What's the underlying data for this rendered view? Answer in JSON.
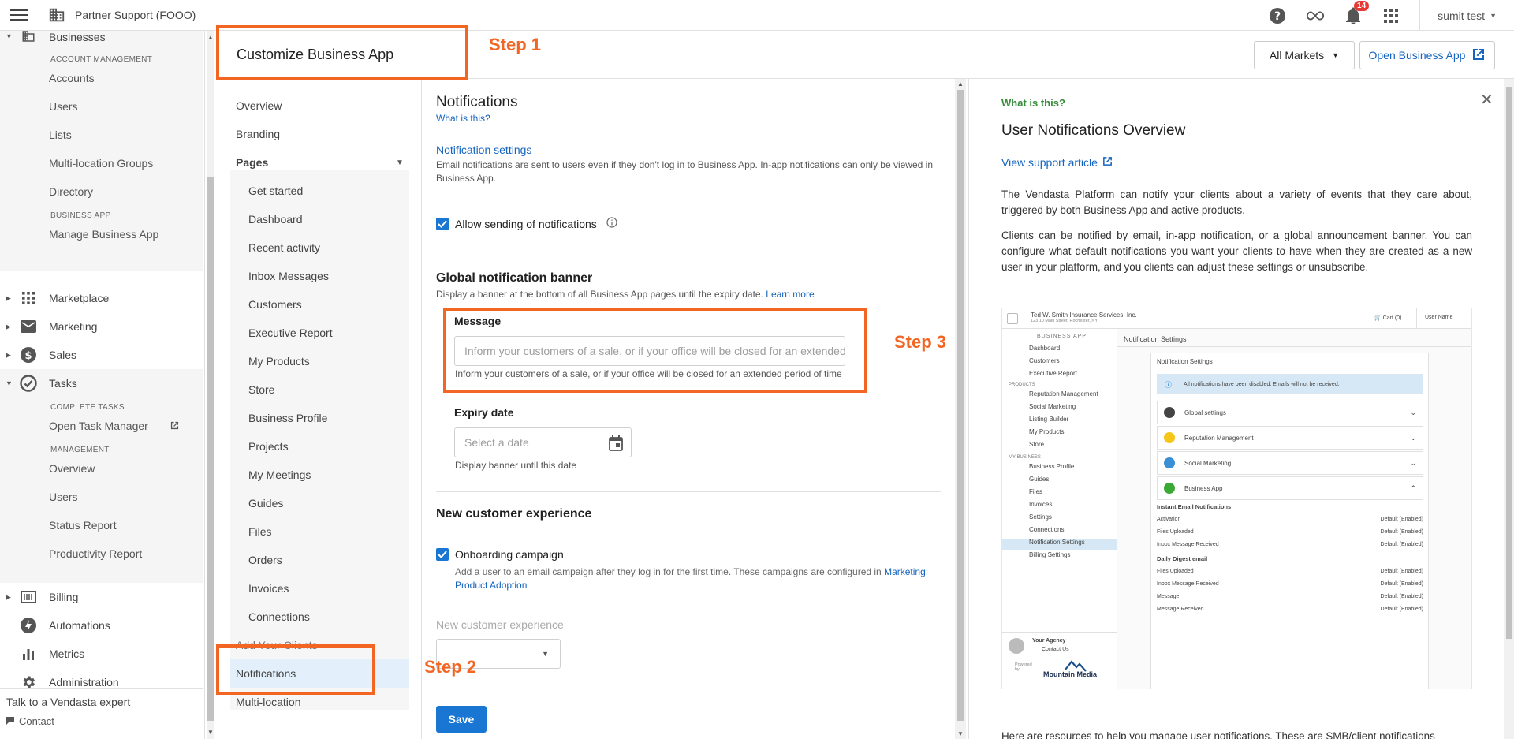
{
  "topbar": {
    "title": "Partner Support (FOOO)",
    "notification_count": "14",
    "user": "sumit test"
  },
  "sidebar": {
    "businesses": "Businesses",
    "section_account": "ACCOUNT MANAGEMENT",
    "accounts": "Accounts",
    "users": "Users",
    "lists": "Lists",
    "multi_location_groups": "Multi-location Groups",
    "directory": "Directory",
    "section_business_app": "BUSINESS APP",
    "manage_business_app": "Manage Business App",
    "marketplace": "Marketplace",
    "marketing": "Marketing",
    "sales": "Sales",
    "tasks": "Tasks",
    "section_complete_tasks": "COMPLETE TASKS",
    "open_task_manager": "Open Task Manager",
    "section_management": "MANAGEMENT",
    "overview": "Overview",
    "users2": "Users",
    "status_report": "Status Report",
    "productivity_report": "Productivity Report",
    "billing": "Billing",
    "automations": "Automations",
    "metrics": "Metrics",
    "administration": "Administration",
    "talk": "Talk to a Vendasta expert",
    "contact": "Contact"
  },
  "header": {
    "title": "Customize Business App",
    "markets": "All Markets",
    "open_app": "Open Business App"
  },
  "subnav": {
    "overview": "Overview",
    "branding": "Branding",
    "pages": "Pages",
    "items": [
      "Get started",
      "Dashboard",
      "Recent activity",
      "Inbox Messages",
      "Customers",
      "Executive Report",
      "My Products",
      "Store",
      "Business Profile",
      "Projects",
      "My Meetings",
      "Guides",
      "Files",
      "Orders",
      "Invoices",
      "Connections"
    ],
    "add_clients": "Add Your Clients",
    "notifications": "Notifications",
    "multi_location": "Multi-location"
  },
  "form": {
    "title": "Notifications",
    "what_is_this": "What is this?",
    "settings_link": "Notification settings",
    "settings_desc": "Email notifications are sent to users even if they don't log in to Business App. In-app notifications can only be viewed in Business App.",
    "allow_label": "Allow sending of notifications",
    "banner_title": "Global notification banner",
    "banner_desc": "Display a banner at the bottom of all Business App pages until the expiry date.",
    "learn_more": "Learn more",
    "message_label": "Message",
    "message_placeholder": "Inform your customers of a sale, or if your office will be closed for an extended period of time",
    "message_hint": "Inform your customers of a sale, or if your office will be closed for an extended period of time",
    "expiry_label": "Expiry date",
    "expiry_placeholder": "Select a date",
    "expiry_hint": "Display banner until this date",
    "nce_title": "New customer experience",
    "onboarding_label": "Onboarding campaign",
    "onboarding_desc": "Add a user to an email campaign after they log in for the first time. These campaigns are configured in",
    "onboarding_link": "Marketing: Product Adoption",
    "nce_select_label": "New customer experience",
    "save": "Save"
  },
  "help": {
    "what": "What is this?",
    "title": "User Notifications Overview",
    "support_link": "View support article",
    "para1": "The Vendasta Platform can notify your clients about a variety of events that they care about, triggered by both Business App and active products.",
    "para2": "Clients can be notified by email, in-app notification, or a global announcement banner. You can configure what default notifications you want your clients to have when they are created as a new user in your platform, and you clients can adjust these settings or unsubscribe.",
    "para3": "Here are resources to help you manage user notifications. These are SMB/client notifications"
  },
  "screenshot": {
    "company": "Ted W. Smith Insurance Services, Inc.",
    "address": "123 10 Main Street, Rochester, NY",
    "cart": "Cart (0)",
    "user": "User Name",
    "business_app": "BUSINESS APP",
    "page_title": "Notification Settings",
    "card_title": "Notification Settings",
    "alert": "All notifications have been disabled. Emails will not be received.",
    "side_items": [
      "Dashboard",
      "Customers",
      "Executive Report"
    ],
    "products_heading": "PRODUCTS",
    "product_items": [
      "Reputation Management",
      "Social Marketing",
      "Listing Builder",
      "My Products",
      "Store"
    ],
    "mybiz_heading": "MY BUSINESS",
    "mybiz_items": [
      "Business Profile",
      "Guides",
      "Files",
      "Invoices",
      "Settings",
      "Connections",
      "Notification Settings",
      "Billing Settings"
    ],
    "agency": "Your Agency",
    "contact_us": "Contact Us",
    "powered": "Powered by",
    "brand": "Mountain Media",
    "accordions": [
      "Global settings",
      "Reputation Management",
      "Social Marketing",
      "Business App"
    ],
    "instant_heading": "Instant Email Notifications",
    "instant_rows": [
      "Activation",
      "Files Uploaded",
      "Inbox Message Received"
    ],
    "digest_heading": "Daily Digest email",
    "digest_rows": [
      "Files Uploaded",
      "Inbox Message Received",
      "Message",
      "Message Received"
    ],
    "default_value": "Default (Enabled)"
  },
  "annotations": {
    "step1": "Step 1",
    "step2": "Step 2",
    "step3": "Step 3",
    "color": "#f26522"
  }
}
